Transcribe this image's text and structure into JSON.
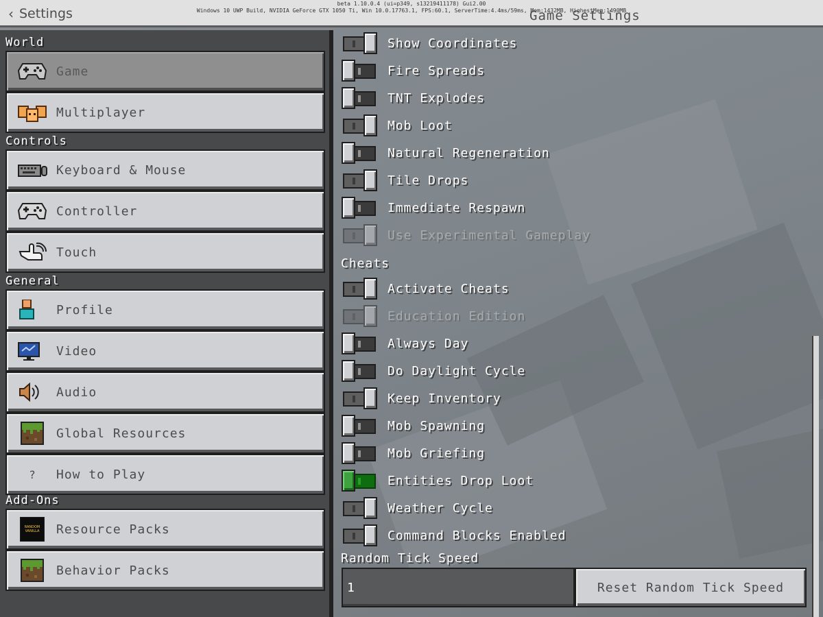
{
  "header": {
    "back_label": "Settings",
    "debug_line1": "beta 1.10.0.4 (ui=p349, s13219411178) Gui2.00",
    "debug_line2": "Windows 10 UWP Build, NVIDIA GeForce GTX 1050 Ti, Win 10.0.17763.1, FPS:60.1, ServerTime:4.4ms/59ms, Mem:1432MB, HighestMem:1490MB",
    "title": "Game Settings"
  },
  "sidebar": {
    "sections": [
      {
        "label": "World",
        "items": [
          {
            "label": "Game",
            "icon": "controller-icon",
            "selected": true
          },
          {
            "label": "Multiplayer",
            "icon": "multiplayer-icon"
          }
        ]
      },
      {
        "label": "Controls",
        "items": [
          {
            "label": "Keyboard & Mouse",
            "icon": "keyboard-icon"
          },
          {
            "label": "Controller",
            "icon": "controller-icon"
          },
          {
            "label": "Touch",
            "icon": "touch-icon"
          }
        ]
      },
      {
        "label": "General",
        "items": [
          {
            "label": "Profile",
            "icon": "profile-icon"
          },
          {
            "label": "Video",
            "icon": "monitor-icon"
          },
          {
            "label": "Audio",
            "icon": "speaker-icon"
          },
          {
            "label": "Global Resources",
            "icon": "grass-block-icon"
          },
          {
            "label": "How to Play",
            "icon": "question-icon",
            "icon_text": "?"
          }
        ]
      },
      {
        "label": "Add-Ons",
        "items": [
          {
            "label": "Resource Packs",
            "icon": "resource-pack-icon",
            "icon_text": "RANDOM VANILLA"
          },
          {
            "label": "Behavior Packs",
            "icon": "grass-block-icon"
          }
        ]
      }
    ]
  },
  "settings": {
    "toggles": [
      {
        "label": "Show Coordinates",
        "state": "on"
      },
      {
        "label": "Fire Spreads",
        "state": "off"
      },
      {
        "label": "TNT Explodes",
        "state": "off"
      },
      {
        "label": "Mob Loot",
        "state": "on"
      },
      {
        "label": "Natural Regeneration",
        "state": "off"
      },
      {
        "label": "Tile Drops",
        "state": "on"
      },
      {
        "label": "Immediate Respawn",
        "state": "off"
      },
      {
        "label": "Use Experimental Gameplay",
        "state": "on",
        "disabled": true
      }
    ],
    "cheats_label": "Cheats",
    "cheat_toggles": [
      {
        "label": "Activate Cheats",
        "state": "on"
      },
      {
        "label": "Education Edition",
        "state": "on",
        "disabled": true
      },
      {
        "label": "Always Day",
        "state": "off"
      },
      {
        "label": "Do Daylight Cycle",
        "state": "off"
      },
      {
        "label": "Keep Inventory",
        "state": "on"
      },
      {
        "label": "Mob Spawning",
        "state": "off"
      },
      {
        "label": "Mob Griefing",
        "state": "off"
      },
      {
        "label": "Entities Drop Loot",
        "state": "off",
        "focused": true
      },
      {
        "label": "Weather Cycle",
        "state": "on"
      },
      {
        "label": "Command Blocks Enabled",
        "state": "on"
      }
    ],
    "random_tick": {
      "label": "Random Tick Speed",
      "value": "1",
      "reset_label": "Reset Random Tick Speed"
    }
  },
  "colors": {
    "toggle_focus": "#0e6d0e",
    "panel_bg": "#48494a",
    "button_bg": "#d0d1d4"
  }
}
